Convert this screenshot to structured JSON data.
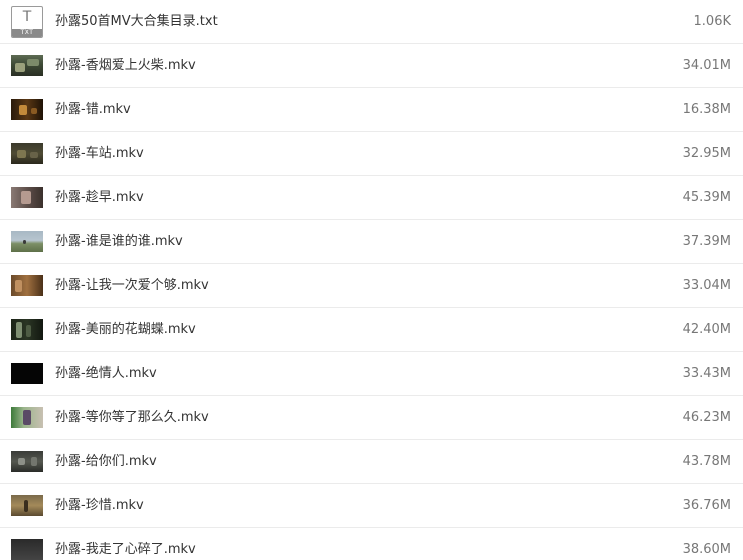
{
  "files": [
    {
      "name": "孙露50首MV大合集目录.txt",
      "size": "1.06K",
      "icon": "txt-file-icon",
      "icon_letter": "T",
      "icon_label": "TXT"
    },
    {
      "name": "孙露-香烟爱上火柴.mkv",
      "size": "34.01M",
      "icon": "video-thumbnail"
    },
    {
      "name": "孙露-错.mkv",
      "size": "16.38M",
      "icon": "video-thumbnail"
    },
    {
      "name": "孙露-车站.mkv",
      "size": "32.95M",
      "icon": "video-thumbnail"
    },
    {
      "name": "孙露-趁早.mkv",
      "size": "45.39M",
      "icon": "video-thumbnail"
    },
    {
      "name": "孙露-谁是谁的谁.mkv",
      "size": "37.39M",
      "icon": "video-thumbnail"
    },
    {
      "name": "孙露-让我一次爱个够.mkv",
      "size": "33.04M",
      "icon": "video-thumbnail"
    },
    {
      "name": "孙露-美丽的花蝴蝶.mkv",
      "size": "42.40M",
      "icon": "video-thumbnail"
    },
    {
      "name": "孙露-绝情人.mkv",
      "size": "33.43M",
      "icon": "video-thumbnail"
    },
    {
      "name": "孙露-等你等了那么久.mkv",
      "size": "46.23M",
      "icon": "video-thumbnail"
    },
    {
      "name": "孙露-给你们.mkv",
      "size": "43.78M",
      "icon": "video-thumbnail"
    },
    {
      "name": "孙露-珍惜.mkv",
      "size": "36.76M",
      "icon": "video-thumbnail"
    },
    {
      "name": "孙露-我走了心碎了.mkv",
      "size": "38.60M",
      "icon": "video-thumbnail"
    }
  ]
}
